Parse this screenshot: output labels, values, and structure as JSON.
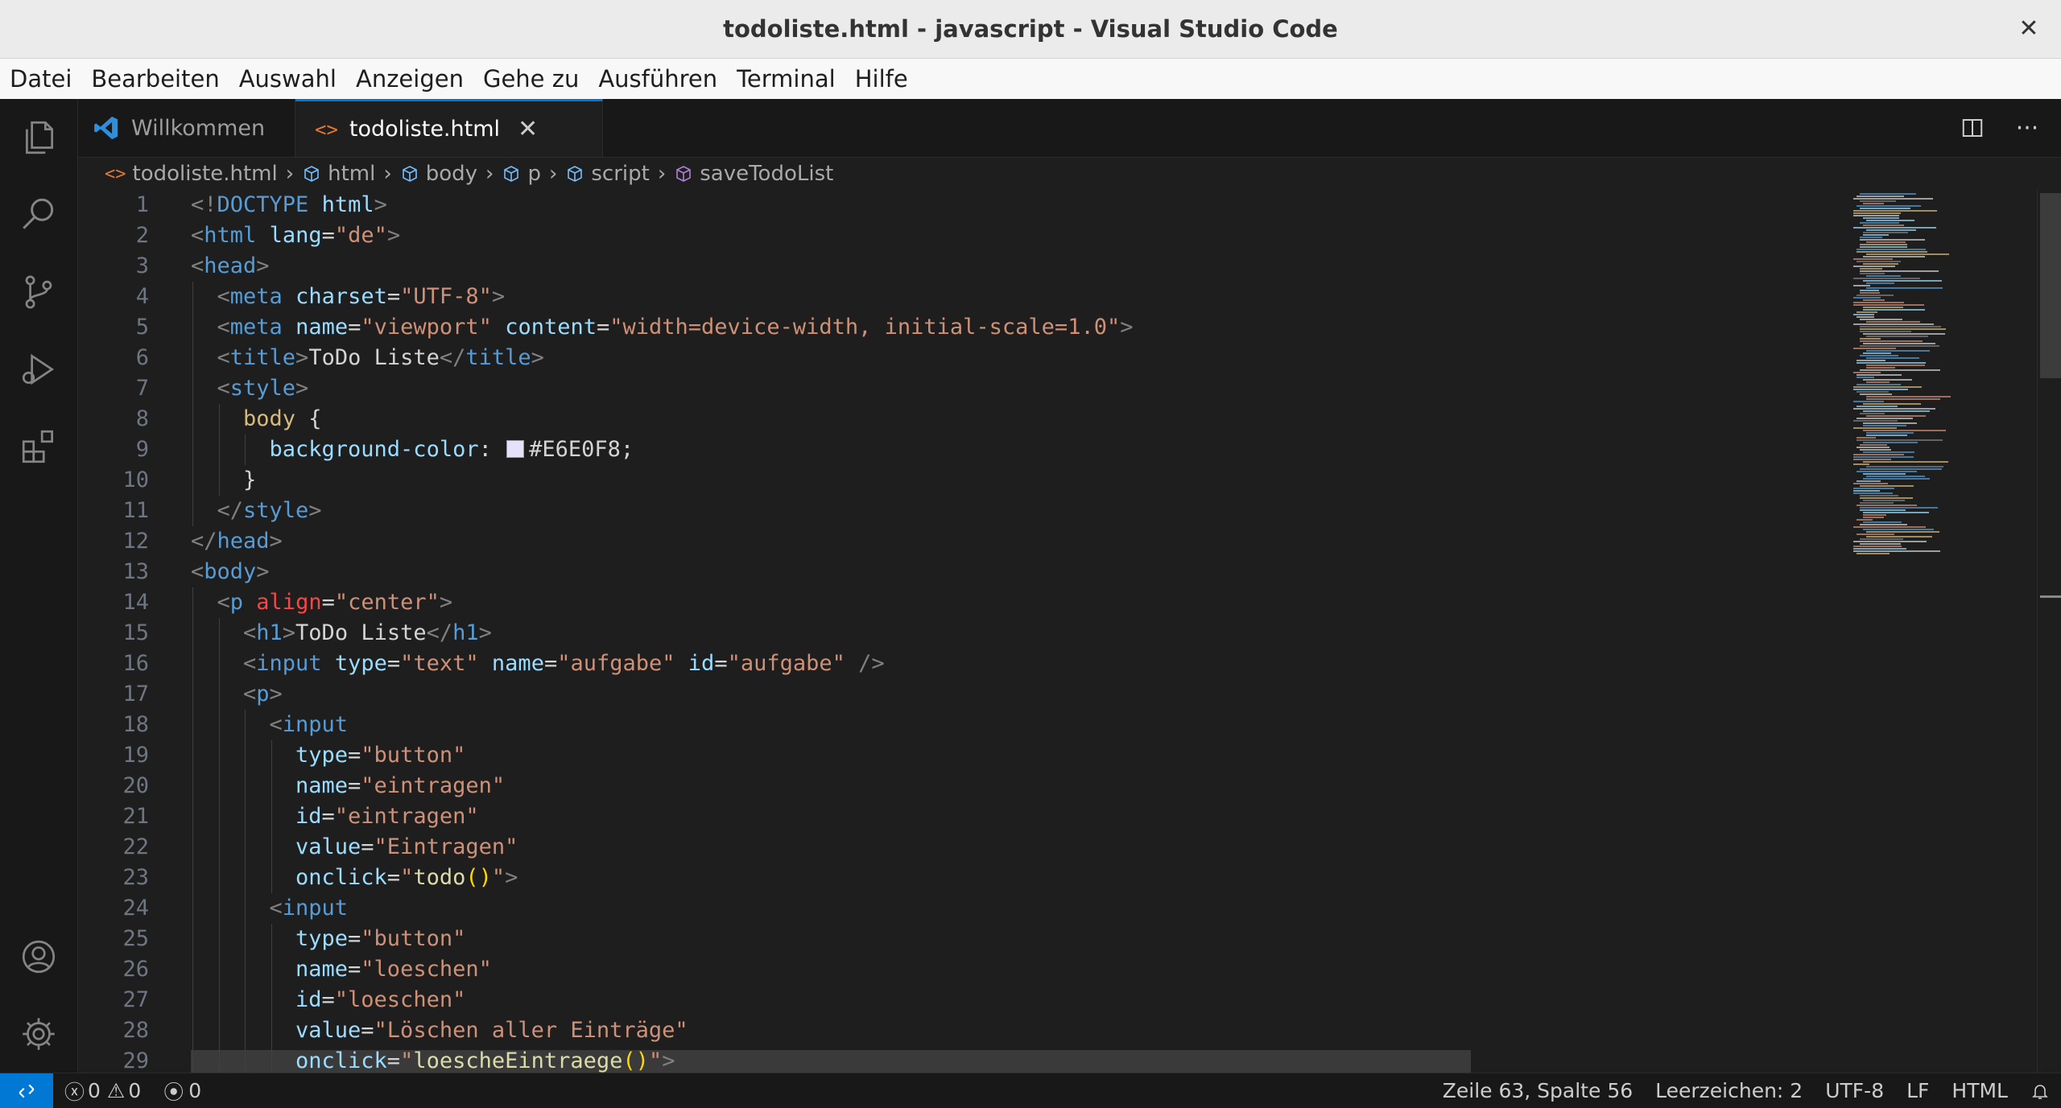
{
  "window": {
    "title": "todoliste.html - javascript - Visual Studio Code"
  },
  "menu": [
    "Datei",
    "Bearbeiten",
    "Auswahl",
    "Anzeigen",
    "Gehe zu",
    "Ausführen",
    "Terminal",
    "Hilfe"
  ],
  "tabs": [
    {
      "label": "Willkommen",
      "icon": "vscode-logo-icon",
      "active": false
    },
    {
      "label": "todoliste.html",
      "icon": "html-file-icon",
      "active": true
    }
  ],
  "breadcrumb": [
    "todoliste.html",
    "html",
    "body",
    "p",
    "script",
    "saveTodoList"
  ],
  "editor": {
    "lines": [
      {
        "n": "1",
        "indent": 0,
        "tokens": [
          [
            "p",
            "<!"
          ],
          [
            "tag",
            "DOCTYPE"
          ],
          [
            "txt",
            " "
          ],
          [
            "attr",
            "html"
          ],
          [
            "p",
            ">"
          ]
        ]
      },
      {
        "n": "2",
        "indent": 0,
        "tokens": [
          [
            "p",
            "<"
          ],
          [
            "tag",
            "html"
          ],
          [
            "txt",
            " "
          ],
          [
            "attr",
            "lang"
          ],
          [
            "txt",
            "="
          ],
          [
            "str",
            "\"de\""
          ],
          [
            "p",
            ">"
          ]
        ]
      },
      {
        "n": "3",
        "indent": 0,
        "tokens": [
          [
            "p",
            "<"
          ],
          [
            "tag",
            "head"
          ],
          [
            "p",
            ">"
          ]
        ]
      },
      {
        "n": "4",
        "indent": 1,
        "tokens": [
          [
            "p",
            "<"
          ],
          [
            "tag",
            "meta"
          ],
          [
            "txt",
            " "
          ],
          [
            "attr",
            "charset"
          ],
          [
            "txt",
            "="
          ],
          [
            "str",
            "\"UTF-8\""
          ],
          [
            "p",
            ">"
          ]
        ]
      },
      {
        "n": "5",
        "indent": 1,
        "tokens": [
          [
            "p",
            "<"
          ],
          [
            "tag",
            "meta"
          ],
          [
            "txt",
            " "
          ],
          [
            "attr",
            "name"
          ],
          [
            "txt",
            "="
          ],
          [
            "str",
            "\"viewport\""
          ],
          [
            "txt",
            " "
          ],
          [
            "attr",
            "content"
          ],
          [
            "txt",
            "="
          ],
          [
            "str",
            "\"width=device-width, initial-scale=1.0\""
          ],
          [
            "p",
            ">"
          ]
        ]
      },
      {
        "n": "6",
        "indent": 1,
        "tokens": [
          [
            "p",
            "<"
          ],
          [
            "tag",
            "title"
          ],
          [
            "p",
            ">"
          ],
          [
            "txt",
            "ToDo Liste"
          ],
          [
            "p",
            "</"
          ],
          [
            "tag",
            "title"
          ],
          [
            "p",
            ">"
          ]
        ]
      },
      {
        "n": "7",
        "indent": 1,
        "tokens": [
          [
            "p",
            "<"
          ],
          [
            "tag",
            "style"
          ],
          [
            "p",
            ">"
          ]
        ]
      },
      {
        "n": "8",
        "indent": 2,
        "tokens": [
          [
            "sel",
            "body"
          ],
          [
            "txt",
            " {"
          ]
        ]
      },
      {
        "n": "9",
        "indent": 3,
        "tokens": [
          [
            "prop",
            "background-color"
          ],
          [
            "txt",
            ": "
          ],
          [
            "swatch",
            "#E6E0F8"
          ],
          [
            "txt",
            "#E6E0F8;"
          ]
        ]
      },
      {
        "n": "10",
        "indent": 2,
        "tokens": [
          [
            "txt",
            "}"
          ]
        ]
      },
      {
        "n": "11",
        "indent": 1,
        "tokens": [
          [
            "p",
            "</"
          ],
          [
            "tag",
            "style"
          ],
          [
            "p",
            ">"
          ]
        ]
      },
      {
        "n": "12",
        "indent": 0,
        "tokens": [
          [
            "p",
            "</"
          ],
          [
            "tag",
            "head"
          ],
          [
            "p",
            ">"
          ]
        ]
      },
      {
        "n": "13",
        "indent": 0,
        "tokens": [
          [
            "p",
            "<"
          ],
          [
            "tag",
            "body"
          ],
          [
            "p",
            ">"
          ]
        ]
      },
      {
        "n": "14",
        "indent": 1,
        "tokens": [
          [
            "p",
            "<"
          ],
          [
            "tag",
            "p"
          ],
          [
            "txt",
            " "
          ],
          [
            "al",
            "align"
          ],
          [
            "txt",
            "="
          ],
          [
            "str",
            "\"center\""
          ],
          [
            "p",
            ">"
          ]
        ]
      },
      {
        "n": "15",
        "indent": 2,
        "tokens": [
          [
            "p",
            "<"
          ],
          [
            "tag",
            "h1"
          ],
          [
            "p",
            ">"
          ],
          [
            "txt",
            "ToDo Liste"
          ],
          [
            "p",
            "</"
          ],
          [
            "tag",
            "h1"
          ],
          [
            "p",
            ">"
          ]
        ]
      },
      {
        "n": "16",
        "indent": 2,
        "tokens": [
          [
            "p",
            "<"
          ],
          [
            "tag",
            "input"
          ],
          [
            "txt",
            " "
          ],
          [
            "attr",
            "type"
          ],
          [
            "txt",
            "="
          ],
          [
            "str",
            "\"text\""
          ],
          [
            "txt",
            " "
          ],
          [
            "attr",
            "name"
          ],
          [
            "txt",
            "="
          ],
          [
            "str",
            "\"aufgabe\""
          ],
          [
            "txt",
            " "
          ],
          [
            "attr",
            "id"
          ],
          [
            "txt",
            "="
          ],
          [
            "str",
            "\"aufgabe\""
          ],
          [
            "txt",
            " "
          ],
          [
            "p",
            "/>"
          ]
        ]
      },
      {
        "n": "17",
        "indent": 2,
        "tokens": [
          [
            "p",
            "<"
          ],
          [
            "tag",
            "p"
          ],
          [
            "p",
            ">"
          ]
        ]
      },
      {
        "n": "18",
        "indent": 3,
        "tokens": [
          [
            "p",
            "<"
          ],
          [
            "tag",
            "input"
          ]
        ]
      },
      {
        "n": "19",
        "indent": 4,
        "tokens": [
          [
            "attr",
            "type"
          ],
          [
            "txt",
            "="
          ],
          [
            "str",
            "\"button\""
          ]
        ]
      },
      {
        "n": "20",
        "indent": 4,
        "tokens": [
          [
            "attr",
            "name"
          ],
          [
            "txt",
            "="
          ],
          [
            "str",
            "\"eintragen\""
          ]
        ]
      },
      {
        "n": "21",
        "indent": 4,
        "tokens": [
          [
            "attr",
            "id"
          ],
          [
            "txt",
            "="
          ],
          [
            "str",
            "\"eintragen\""
          ]
        ]
      },
      {
        "n": "22",
        "indent": 4,
        "tokens": [
          [
            "attr",
            "value"
          ],
          [
            "txt",
            "="
          ],
          [
            "str",
            "\"Eintragen\""
          ]
        ]
      },
      {
        "n": "23",
        "indent": 4,
        "tokens": [
          [
            "attr",
            "onclick"
          ],
          [
            "txt",
            "="
          ],
          [
            "str",
            "\""
          ],
          [
            "fn",
            "todo"
          ],
          [
            "brk",
            "()"
          ],
          [
            "str",
            "\""
          ],
          [
            "p",
            ">"
          ]
        ]
      },
      {
        "n": "24",
        "indent": 3,
        "tokens": [
          [
            "p",
            "<"
          ],
          [
            "tag",
            "input"
          ]
        ]
      },
      {
        "n": "25",
        "indent": 4,
        "tokens": [
          [
            "attr",
            "type"
          ],
          [
            "txt",
            "="
          ],
          [
            "str",
            "\"button\""
          ]
        ]
      },
      {
        "n": "26",
        "indent": 4,
        "tokens": [
          [
            "attr",
            "name"
          ],
          [
            "txt",
            "="
          ],
          [
            "str",
            "\"loeschen\""
          ]
        ]
      },
      {
        "n": "27",
        "indent": 4,
        "tokens": [
          [
            "attr",
            "id"
          ],
          [
            "txt",
            "="
          ],
          [
            "str",
            "\"loeschen\""
          ]
        ]
      },
      {
        "n": "28",
        "indent": 4,
        "tokens": [
          [
            "attr",
            "value"
          ],
          [
            "txt",
            "="
          ],
          [
            "str",
            "\"Löschen aller Einträge\""
          ]
        ]
      },
      {
        "n": "29",
        "indent": 4,
        "tokens": [
          [
            "attr",
            "onclick"
          ],
          [
            "txt",
            "="
          ],
          [
            "str",
            "\""
          ],
          [
            "fn",
            "loescheEintraege"
          ],
          [
            "brk",
            "()"
          ],
          [
            "str",
            "\""
          ],
          [
            "p",
            ">"
          ]
        ]
      }
    ]
  },
  "status": {
    "errors": "0",
    "warnings": "0",
    "ports": "0",
    "cursor": "Zeile 63, Spalte 56",
    "indent": "Leerzeichen: 2",
    "encoding": "UTF-8",
    "eol": "LF",
    "language": "HTML"
  },
  "colors": {
    "accent": "#0078d4",
    "swatch": "#E6E0F8"
  }
}
